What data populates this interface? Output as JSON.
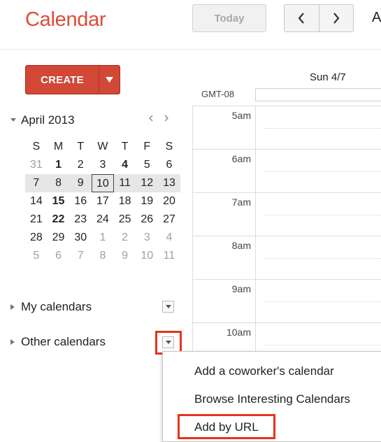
{
  "header": {
    "app_title": "Calendar",
    "today_label": "Today",
    "header_cut_text": "A"
  },
  "create": {
    "label": "CREATE"
  },
  "mini_calendar": {
    "title": "April 2013",
    "weekdays": [
      "S",
      "M",
      "T",
      "W",
      "T",
      "F",
      "S"
    ],
    "weeks": [
      [
        "31",
        "1",
        "2",
        "3",
        "4",
        "5",
        "6"
      ],
      [
        "7",
        "8",
        "9",
        "10",
        "11",
        "12",
        "13"
      ],
      [
        "14",
        "15",
        "16",
        "17",
        "18",
        "19",
        "20"
      ],
      [
        "21",
        "22",
        "23",
        "24",
        "25",
        "26",
        "27"
      ],
      [
        "28",
        "29",
        "30",
        "1",
        "2",
        "3",
        "4"
      ],
      [
        "5",
        "6",
        "7",
        "8",
        "9",
        "10",
        "11"
      ]
    ],
    "selected_day": "10"
  },
  "calendar_lists": {
    "my_calendars": "My calendars",
    "other_calendars": "Other calendars"
  },
  "day_view": {
    "day_header": "Sun 4/7",
    "timezone": "GMT-08",
    "hours": [
      "5am",
      "6am",
      "7am",
      "8am",
      "9am",
      "10am"
    ]
  },
  "other_menu": {
    "items": [
      "Add a coworker's calendar",
      "Browse Interesting Calendars",
      "Add by URL"
    ]
  },
  "colors": {
    "brand_red": "#dd4b39",
    "create_button": "#d14836",
    "highlight_outline": "#e5331e"
  }
}
